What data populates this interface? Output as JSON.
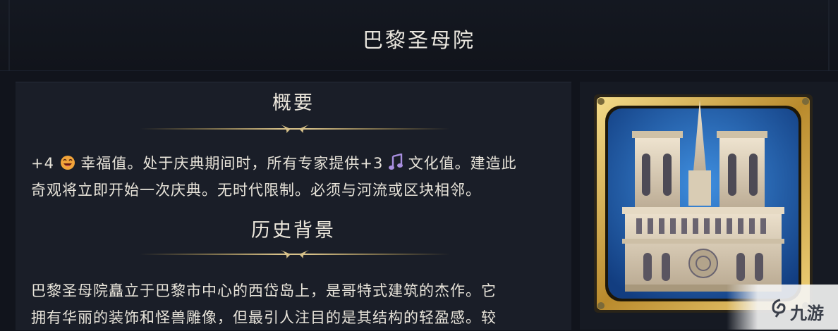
{
  "header": {
    "title": "巴黎圣母院"
  },
  "overview": {
    "title": "概要",
    "amenity_value": "+4",
    "amenity_text": "幸福值。处于庆典期间时，所有专家提供+3",
    "culture_text": "文化值。建造此",
    "line2": "奇观将立即开始一次庆典。无时代限制。必须与河流或区块相邻。"
  },
  "history": {
    "title": "历史背景",
    "line1": "巴黎圣母院矗立于巴黎市中心的西岱岛上，是哥特式建筑的杰作。它",
    "line2": "拥有华丽的装饰和怪兽雕像，但最引人注目的是其结构的轻盈感。较"
  },
  "icons": {
    "amenity": "happy-face-icon",
    "culture": "music-note-icon",
    "wonder": "notre-dame-wonder-image"
  },
  "colors": {
    "gold": "#c9a64b",
    "frame_blue": "#1d5fb0",
    "background": "#11141c"
  },
  "watermark": {
    "text": "九游"
  }
}
